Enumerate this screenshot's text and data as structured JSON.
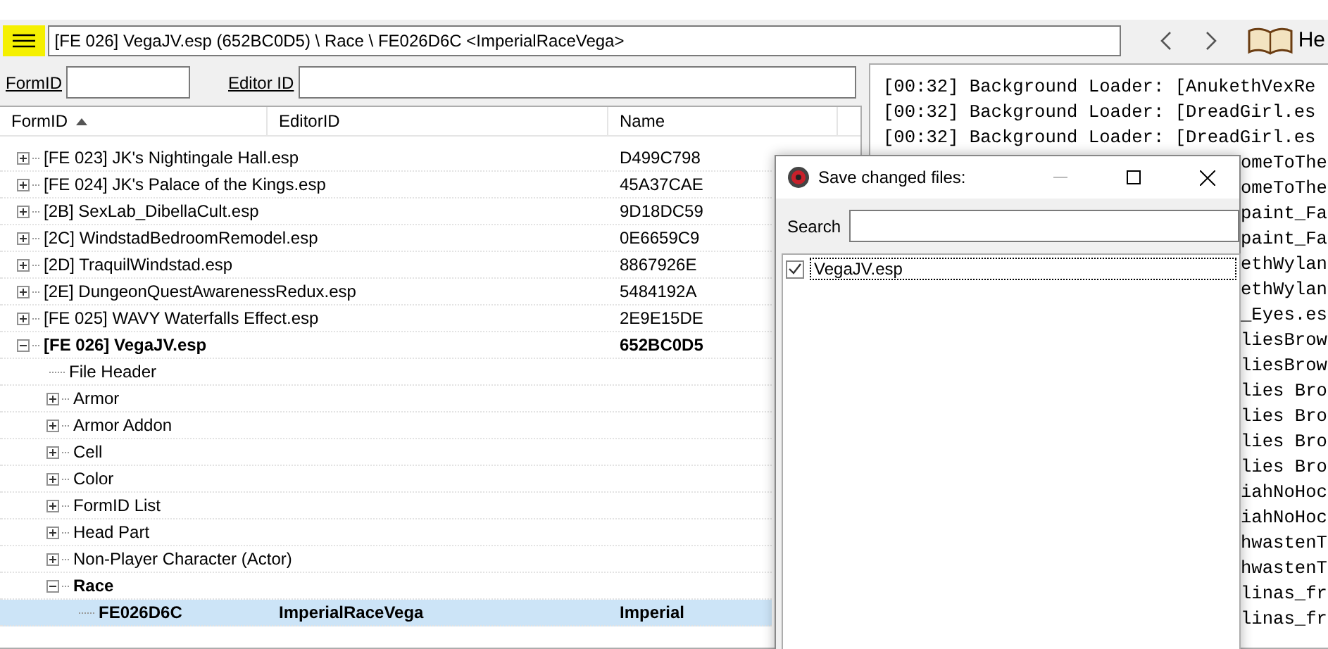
{
  "toolbar": {
    "path": "[FE 026] VegaJV.esp (652BC0D5) \\ Race \\ FE026D6C <ImperialRaceVega>",
    "help_label": "He"
  },
  "filters": [
    {
      "label": "FormID"
    },
    {
      "label": "Editor ID"
    }
  ],
  "tree": {
    "columns": [
      {
        "label": "FormID",
        "sorted": true
      },
      {
        "label": "EditorID"
      },
      {
        "label": "Name"
      }
    ],
    "nodes": [
      {
        "label": "[FE 023] JK's Nightingale Hall.esp",
        "name": "D499C798",
        "expandable": true,
        "expanded": false,
        "modified": false,
        "selected": false
      },
      {
        "label": "[FE 024] JK's Palace of the Kings.esp",
        "name": "45A37CAE",
        "expandable": true,
        "expanded": false,
        "modified": false,
        "selected": false
      },
      {
        "label": "[2B] SexLab_DibellaCult.esp",
        "name": "9D18DC59",
        "expandable": true,
        "expanded": false,
        "modified": false,
        "selected": false
      },
      {
        "label": "[2C] WindstadBedroomRemodel.esp",
        "name": "0E6659C9",
        "expandable": true,
        "expanded": false,
        "modified": false,
        "selected": false
      },
      {
        "label": "[2D] TraquilWindstad.esp",
        "name": "8867926E",
        "expandable": true,
        "expanded": false,
        "modified": false,
        "selected": false
      },
      {
        "label": "[2E] DungeonQuestAwarenessRedux.esp",
        "name": "5484192A",
        "expandable": true,
        "expanded": false,
        "modified": false,
        "selected": false
      },
      {
        "label": "[FE 025] WAVY Waterfalls Effect.esp",
        "name": "2E9E15DE",
        "expandable": true,
        "expanded": false,
        "modified": false,
        "selected": false
      },
      {
        "label": "[FE 026] VegaJV.esp",
        "name": "652BC0D5",
        "expandable": true,
        "expanded": true,
        "modified": true,
        "selected": false,
        "children": [
          {
            "label": "File Header",
            "expandable": false,
            "modified": false,
            "selected": false
          },
          {
            "label": "Armor",
            "expandable": true,
            "expanded": false,
            "modified": false,
            "selected": false
          },
          {
            "label": "Armor Addon",
            "expandable": true,
            "expanded": false,
            "modified": false,
            "selected": false
          },
          {
            "label": "Cell",
            "expandable": true,
            "expanded": false,
            "modified": false,
            "selected": false
          },
          {
            "label": "Color",
            "expandable": true,
            "expanded": false,
            "modified": false,
            "selected": false
          },
          {
            "label": "FormID List",
            "expandable": true,
            "expanded": false,
            "modified": false,
            "selected": false
          },
          {
            "label": "Head Part",
            "expandable": true,
            "expanded": false,
            "modified": false,
            "selected": false
          },
          {
            "label": "Non-Player Character (Actor)",
            "expandable": true,
            "expanded": false,
            "modified": false,
            "selected": false
          },
          {
            "label": "Race",
            "expandable": true,
            "expanded": true,
            "modified": true,
            "selected": false,
            "children": [
              {
                "label": "FE026D6C",
                "editor_id": "ImperialRaceVega",
                "name": "Imperial",
                "expandable": false,
                "modified": true,
                "selected": true
              }
            ]
          }
        ]
      }
    ]
  },
  "log": [
    {
      "kind": "full",
      "text": "[00:32] Background Loader: [AnukethVexRe"
    },
    {
      "kind": "full",
      "text": "[00:32] Background Loader: [DreadGirl.es"
    },
    {
      "kind": "full",
      "text": "[00:32] Background Loader: [DreadGirl.es"
    },
    {
      "kind": "fragment",
      "text": "omeToThe"
    },
    {
      "kind": "fragment",
      "text": "omeToThe"
    },
    {
      "kind": "fragment",
      "text": "paint_Fa"
    },
    {
      "kind": "fragment",
      "text": "paint_Fa"
    },
    {
      "kind": "fragment",
      "text": "ethWylan"
    },
    {
      "kind": "fragment",
      "text": "ethWylan"
    },
    {
      "kind": "fragment",
      "text": "_Eyes.es"
    },
    {
      "kind": "fragment",
      "text": "liesBrow"
    },
    {
      "kind": "fragment",
      "text": "liesBrow"
    },
    {
      "kind": "fragment",
      "text": "lies Bro"
    },
    {
      "kind": "fragment",
      "text": "lies Bro"
    },
    {
      "kind": "fragment",
      "text": "lies Bro"
    },
    {
      "kind": "fragment",
      "text": "lies Bro"
    },
    {
      "kind": "fragment",
      "text": "iahNoHoc"
    },
    {
      "kind": "fragment",
      "text": "iahNoHoc"
    },
    {
      "kind": "fragment",
      "text": "hwastenT"
    },
    {
      "kind": "fragment",
      "text": "hwastenT"
    },
    {
      "kind": "fragment",
      "text": "linas_fr"
    },
    {
      "kind": "fragment",
      "text": "linas_fr"
    }
  ],
  "dialog": {
    "title": "Save changed files:",
    "search_label": "Search",
    "files": [
      {
        "label": "VegaJV.esp",
        "checked": true,
        "selected": true
      }
    ]
  }
}
